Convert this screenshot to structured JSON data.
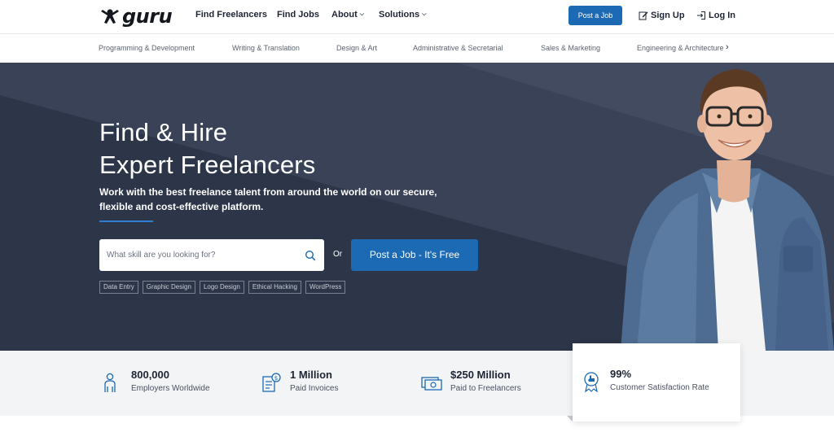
{
  "nav": {
    "logo_text": "guru",
    "links": [
      {
        "label": "Find Freelancers",
        "has_caret": false
      },
      {
        "label": "Find Jobs",
        "has_caret": false
      },
      {
        "label": "About",
        "has_caret": true
      },
      {
        "label": "Solutions",
        "has_caret": true
      }
    ],
    "post_job_label": "Post a Job",
    "sign_up_label": "Sign Up",
    "log_in_label": "Log In"
  },
  "categories": {
    "items": [
      "Programming & Development",
      "Writing & Translation",
      "Design & Art",
      "Administrative & Secretarial",
      "Sales & Marketing",
      "Engineering & Architecture"
    ],
    "more_icon": "chevron-right-icon"
  },
  "hero": {
    "title_line1": "Find & Hire",
    "title_line2": "Expert Freelancers",
    "subtitle": "Work with the best freelance talent from around the world on our secure, flexible and cost-effective platform.",
    "search_placeholder": "What skill are you looking for?",
    "or_text": "Or",
    "post_job_label": "Post a Job - It's Free",
    "tags": [
      "Data Entry",
      "Graphic Design",
      "Logo Design",
      "Ethical Hacking",
      "WordPress"
    ]
  },
  "stats": [
    {
      "value": "800,000",
      "label": "Employers Worldwide",
      "icon": "person-icon"
    },
    {
      "value": "1 Million",
      "label": "Paid Invoices",
      "icon": "invoice-icon"
    },
    {
      "value": "$250 Million",
      "label": "Paid to Freelancers",
      "icon": "money-icon"
    },
    {
      "value": "99%",
      "label": "Customer Satisfaction Rate",
      "icon": "award-badge-icon"
    }
  ],
  "colors": {
    "brand_blue": "#1b6ab3",
    "hero_dark": "#2d3548",
    "hero_light": "#353d52",
    "stats_bg": "#f3f4f5"
  }
}
